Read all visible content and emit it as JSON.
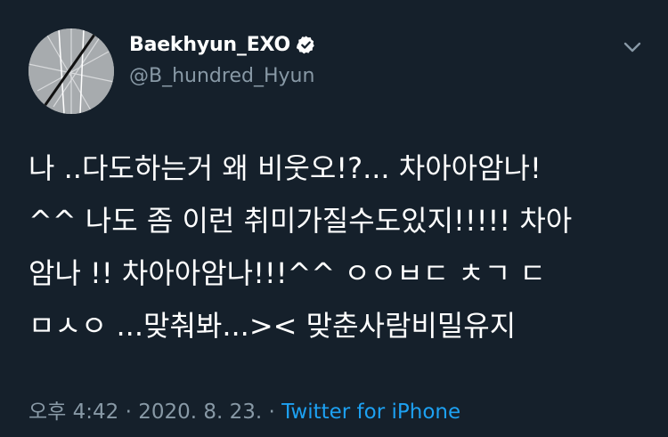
{
  "user": {
    "display_name": "Baekhyun_EXO",
    "handle": "@B_hundred_Hyun",
    "verified": true
  },
  "icons": {
    "verified": "verified-badge-icon",
    "menu": "chevron-down-icon"
  },
  "tweet": {
    "lines": [
      "나 ..다도하는거 왜 비웃오!?... 차아아암나!",
      "^^ 나도 좀 이런 취미가질수도있지!!!!! 차아",
      "암나 !! 차아아암나!!!^^ ㅇㅇㅂㄷ ㅊㄱ ㄷ",
      "ㅁㅅㅇ ...맞춰봐...>< 맞춘사람비밀유지"
    ]
  },
  "meta": {
    "time": "오후 4:42",
    "separator1": " · ",
    "date": "2020. 8. 23.",
    "separator2": " · ",
    "source": "Twitter for iPhone"
  },
  "colors": {
    "background": "#15202b",
    "text": "#ffffff",
    "secondary": "#8899a6",
    "accent": "#1da1f2"
  }
}
